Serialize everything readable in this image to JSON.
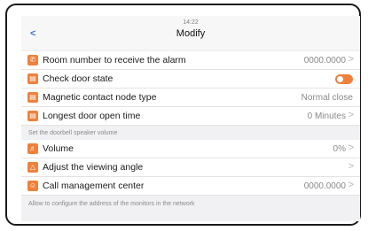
{
  "header": {
    "back_label": "<",
    "clock": "14:22",
    "title": "Modify"
  },
  "settings": [
    {
      "label": "Room number to receive the alarm",
      "value": "0000.0000",
      "icon": "phone-icon"
    },
    {
      "label": "Check door state",
      "value": "",
      "icon": "door-icon",
      "toggle": true
    },
    {
      "label": "Magnetic contact node type",
      "value": "Normal close",
      "icon": "door-icon"
    },
    {
      "label": "Longest door open time",
      "value": "0 Minutes",
      "icon": "door-icon"
    }
  ],
  "section1": "Set the doorbell speaker volume",
  "settings2": [
    {
      "label": "Volume",
      "value": "0%",
      "icon": "speaker-icon"
    },
    {
      "label": "Adjust the viewing angle",
      "value": "",
      "icon": "triangle-icon"
    },
    {
      "label": "Call management center",
      "value": "0000.0000",
      "icon": "person-icon"
    }
  ],
  "section2": "Allow to configure the address of the monitors in the network",
  "chevron": ">",
  "colors": {
    "accent": "#f0803a",
    "back": "#3d6de0"
  }
}
